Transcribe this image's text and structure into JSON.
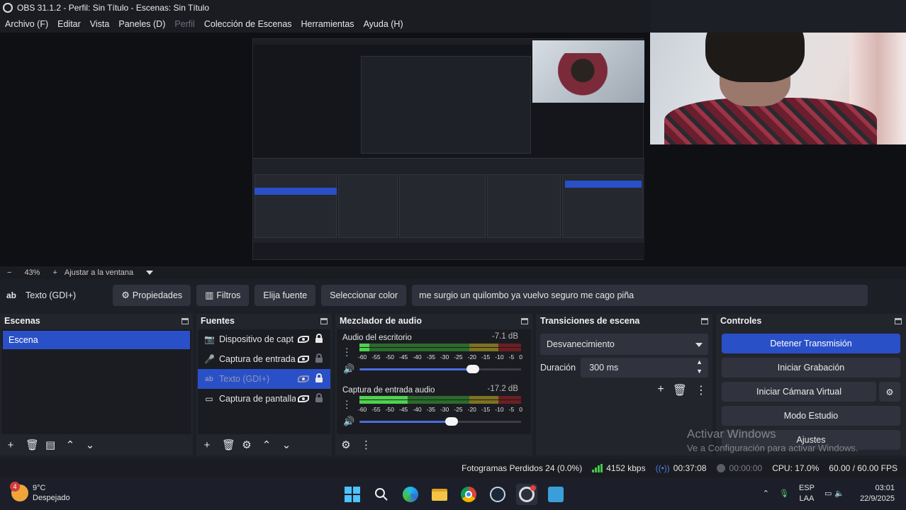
{
  "window": {
    "title": "OBS 31.1.2 - Perfil: Sin Título - Escenas: Sin Título"
  },
  "menu": [
    "Archivo (F)",
    "Editar",
    "Vista",
    "Paneles (D)",
    "Perfil",
    "Colección de Escenas",
    "Herramientas",
    "Ayuda (H)"
  ],
  "zoom": {
    "minus": "−",
    "value": "43%",
    "plus": "+",
    "fit": "Ajustar a la ventana"
  },
  "source_toolbar": {
    "type_icon": "ab",
    "source_name": "Texto (GDI+)",
    "properties": "Propiedades",
    "filters": "Filtros",
    "font": "Elija fuente",
    "color": "Seleccionar color",
    "text_value": "me surgio un quilombo ya vuelvo seguro me cago piña"
  },
  "scenes": {
    "title": "Escenas",
    "items": [
      "Escena"
    ],
    "selected": "Escena"
  },
  "sources": {
    "title": "Fuentes",
    "items": [
      {
        "icon": "camera-icon",
        "name": "Dispositivo de capt",
        "visible": true,
        "locked": true
      },
      {
        "icon": "mic-icon",
        "name": "Captura de entrada",
        "visible": true,
        "locked": false
      },
      {
        "icon": "text-icon",
        "name": "Texto (GDI+)",
        "visible": false,
        "locked": true,
        "selected": true
      },
      {
        "icon": "monitor-icon",
        "name": "Captura de pantalla",
        "visible": true,
        "locked": false
      }
    ]
  },
  "mixer": {
    "title": "Mezclador de audio",
    "channels": [
      {
        "name": "Audio del escritorio",
        "db": "-7.1 dB",
        "level": 0.06,
        "volume": 0.7
      },
      {
        "name": "Captura de entrada audio",
        "db": "-17.2 dB",
        "level": 0.3,
        "volume": 0.57
      }
    ],
    "ticks": [
      "-60",
      "-55",
      "-50",
      "-45",
      "-40",
      "-35",
      "-30",
      "-25",
      "-20",
      "-15",
      "-10",
      "-5",
      "0"
    ]
  },
  "transitions": {
    "title": "Transiciones de escena",
    "selected": "Desvanecimiento",
    "duration_label": "Duración",
    "duration_value": "300 ms"
  },
  "controls": {
    "title": "Controles",
    "stop_stream": "Detener Transmisión",
    "start_recording": "Iniciar Grabación",
    "virtual_cam": "Iniciar Cámara Virtual",
    "studio_mode": "Modo Estudio",
    "settings": "Ajustes"
  },
  "watermark": {
    "line1": "Activar Windows",
    "line2": "Ve a Configuración para activar Windows."
  },
  "status": {
    "dropped_frames": "Fotogramas Perdidos 24 (0.0%)",
    "bitrate": "4152 kbps",
    "stream_time": "00:37:08",
    "rec_time": "00:00:00",
    "cpu": "CPU: 17.0%",
    "fps": "60.00 / 60.00 FPS"
  },
  "taskbar": {
    "weather_badge": "4",
    "temp": "9°C",
    "condition": "Despejado",
    "lang1": "ESP",
    "lang2": "LAA",
    "time": "03:01",
    "date": "22/9/2025"
  },
  "colors": {
    "accent": "#2a50c8",
    "panel": "#23252d",
    "button": "#30333d",
    "meter_green": "#4fd14f"
  }
}
